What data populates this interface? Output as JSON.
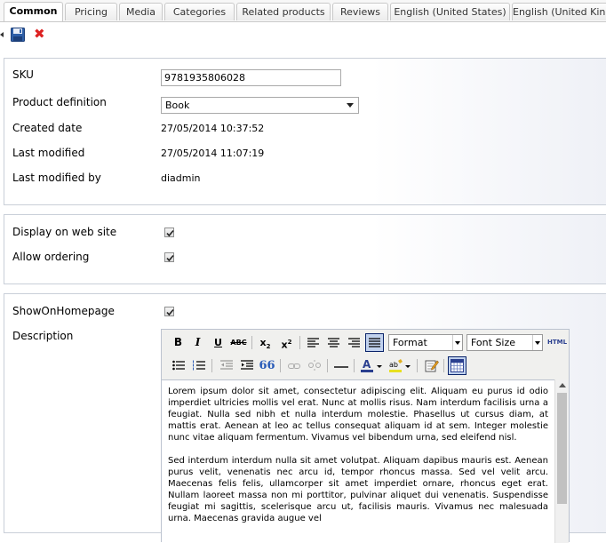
{
  "tabs": [
    "Common",
    "Pricing",
    "Media",
    "Categories",
    "Related products",
    "Reviews",
    "English (United States)",
    "English (United Kingdom)"
  ],
  "active_tab": "Common",
  "toolbar": {
    "save_icon": "floppy-disk-icon",
    "cancel_icon": "red-x-icon",
    "cancel_glyph": "✖"
  },
  "common": {
    "sku_label": "SKU",
    "sku_value": "9781935806028",
    "product_definition_label": "Product definition",
    "product_definition_value": "Book",
    "created_date_label": "Created date",
    "created_date_value": "27/05/2014 10:37:52",
    "last_modified_label": "Last modified",
    "last_modified_value": "27/05/2014 11:07:19",
    "last_modified_by_label": "Last modified by",
    "last_modified_by_value": "diadmin"
  },
  "visibility": {
    "display_label": "Display on web site",
    "display_checked": true,
    "ordering_label": "Allow ordering",
    "ordering_checked": true
  },
  "content_panel": {
    "show_on_homepage_label": "ShowOnHomepage",
    "show_on_homepage_checked": true,
    "description_label": "Description"
  },
  "editor": {
    "bold": "B",
    "italic": "I",
    "underline": "U",
    "strike": "ABC",
    "format_label": "Format",
    "font_size_label": "Font Size",
    "html_label": "HTML",
    "blockquote": "66",
    "paragraph1": "Lorem ipsum dolor sit amet, consectetur adipiscing elit. Aliquam eu purus id odio imperdiet ultricies mollis vel erat. Nunc at mollis risus. Nam interdum facilisis urna a feugiat. Nulla sed nibh et nulla interdum molestie. Phasellus ut cursus diam, at mattis erat. Aenean at leo ac tellus consequat aliquam id at sem. Integer molestie nunc vitae aliquam fermentum. Vivamus vel bibendum urna, sed eleifend nisl.",
    "paragraph2": "Sed interdum interdum nulla sit amet volutpat. Aliquam dapibus mauris est. Aenean purus velit, venenatis nec arcu id, tempor rhoncus massa. Sed vel velit arcu. Maecenas felis felis, ullamcorper sit amet imperdiet ornare, rhoncus eget erat. Nullam laoreet massa non mi porttitor, pulvinar aliquet dui venenatis. Suspendisse feugiat mi sagittis, scelerisque arcu ut, facilisis mauris. Vivamus nec malesuada urna. Maecenas gravida augue vel"
  }
}
